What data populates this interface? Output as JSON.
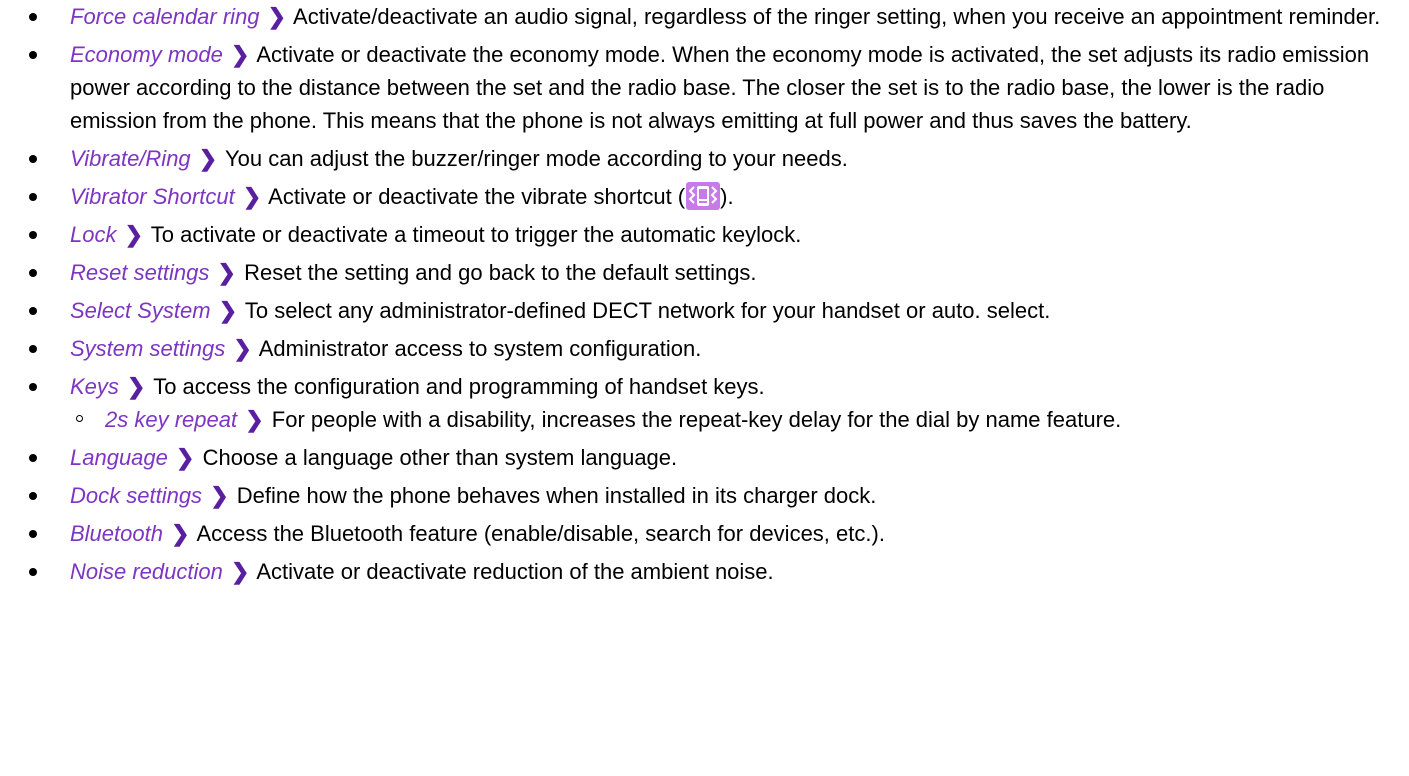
{
  "colors": {
    "term": "#7d35c2",
    "chevron": "#5a1fa0",
    "icon_bg": "#c77be8"
  },
  "separator_glyph": "❯",
  "items": [
    {
      "term": "Force calendar ring",
      "description": "Activate/deactivate an audio signal, regardless of the ringer setting, when you receive an appointment reminder."
    },
    {
      "term": "Economy mode",
      "description": "Activate or deactivate the economy mode. When the economy mode is activated, the set adjusts its radio emission power according to the distance between the set and the radio base. The closer the set is to the radio base, the lower is the radio emission from the phone. This means that the phone is not always emitting at full power and thus saves the battery."
    },
    {
      "term": "Vibrate/Ring",
      "description": "You can adjust the buzzer/ringer mode according to your needs."
    },
    {
      "term": "Vibrator Shortcut",
      "description_before_icon": "Activate or deactivate the vibrate shortcut (",
      "icon": "vibrate-shortcut-icon",
      "description_after_icon": ")."
    },
    {
      "term": "Lock",
      "description": "To activate or deactivate a timeout to trigger the automatic keylock."
    },
    {
      "term": "Reset settings",
      "description": "Reset the setting and go back to the default settings."
    },
    {
      "term": "Select System",
      "description": "To select any administrator-defined DECT network for your handset or auto. select."
    },
    {
      "term": "System settings",
      "description": "Administrator access to system configuration."
    },
    {
      "term": "Keys",
      "description": "To access the configuration and programming of handset keys.",
      "subitems": [
        {
          "term": "2s key repeat",
          "description": "For people with a disability, increases the repeat-key delay for the dial by name feature."
        }
      ]
    },
    {
      "term": "Language",
      "description": "Choose a language other than system language."
    },
    {
      "term": "Dock settings",
      "description": "Define how the phone behaves when installed in its charger dock."
    },
    {
      "term": "Bluetooth",
      "description": "Access the Bluetooth feature (enable/disable, search for devices, etc.)."
    },
    {
      "term": "Noise reduction",
      "description": "Activate or deactivate reduction of the ambient noise."
    }
  ]
}
